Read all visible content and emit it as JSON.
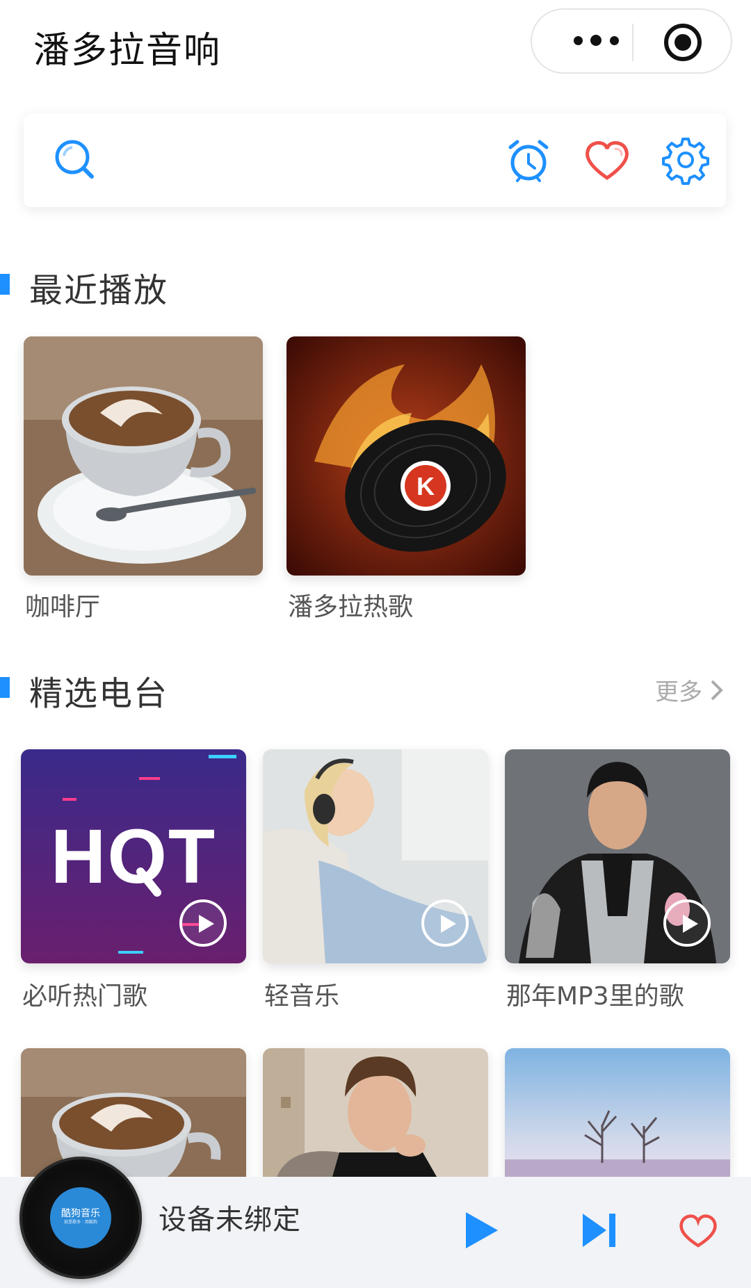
{
  "header": {
    "title": "潘多拉音响"
  },
  "toolbar": {
    "icons": [
      "search-icon",
      "alarm-clock-icon",
      "heart-icon",
      "gear-icon"
    ]
  },
  "recent": {
    "title": "最近播放",
    "items": [
      {
        "label": "咖啡厅",
        "image": "latte-art-cup"
      },
      {
        "label": "潘多拉热歌",
        "image": "flaming-vinyl-record"
      }
    ]
  },
  "radio": {
    "title": "精选电台",
    "more_label": "更多",
    "items": [
      {
        "label": "必听热门歌",
        "image": "hot-text-cover"
      },
      {
        "label": "轻音乐",
        "image": "woman-with-headphones"
      },
      {
        "label": "那年MP3里的歌",
        "image": "man-in-jacket"
      },
      {
        "label": "",
        "image": "latte-art-cup"
      },
      {
        "label": "",
        "image": "young-man-portrait"
      },
      {
        "label": "",
        "image": "winter-trees-landscape"
      }
    ]
  },
  "player": {
    "status": "设备未绑定",
    "disc_brand": "酷狗音乐",
    "disc_tagline": "就是歌多 · 用酷狗",
    "icons": [
      "play-icon",
      "next-track-icon",
      "heart-icon"
    ]
  },
  "colors": {
    "accent": "#1e90ff",
    "heart": "#f0504a",
    "playerBg": "#f1f3f6"
  }
}
